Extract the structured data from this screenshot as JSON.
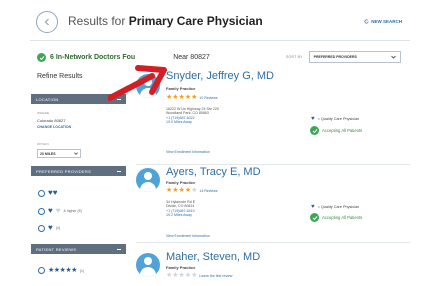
{
  "header": {
    "title_prefix": "Results for ",
    "title_bold": "Primary Care Physician",
    "new_search": "NEW SEARCH"
  },
  "results": {
    "count_bold": "6 In-Network Doctors Fou",
    "count_rest": "Near 80827",
    "sort_label": "SORT BY",
    "sort_value": "PREFERRED PROVIDERS"
  },
  "sidebar": {
    "refine_title": "Refine Results",
    "location": {
      "header": "LOCATION",
      "where_label": "WHERE",
      "where_value": "Colorado 80827",
      "change_link": "CHANGE LOCATION",
      "within_label": "WITHIN",
      "within_value": "20 MILES"
    },
    "preferred": {
      "header": "PREFERRED PROVIDERS",
      "opt2_text": "& higher (5)",
      "opt3_text": "(4)"
    },
    "reviews": {
      "header": "PATIENT REVIEWS",
      "opt1_text": "(1)"
    }
  },
  "doctors": [
    {
      "name": "Snyder, Jeffrey G, MD",
      "specialty": "Family Practice",
      "reviews": "10 Reviews",
      "address1": "16222 W Us Highway 24 Ste 220",
      "address2": "Woodland Park, CO 80863",
      "phone": "+1 (719)687-6022",
      "distance": "19.0 Miles Away",
      "view": "View Enrollment Information",
      "quality": "= Quality Care Physician",
      "accepting": "Accepting All Patients"
    },
    {
      "name": "Ayers, Tracy E, MD",
      "specialty": "Family Practice",
      "reviews": "14 Reviews",
      "address1": "34 Hylanode Rd E",
      "address2": "Divide, CO 80814",
      "phone": "+1 (719)687-6410",
      "distance": "19.2 Miles Away",
      "view": "View Enrollment Information",
      "quality": "= Quality Care Physician",
      "accepting": "Accepting All Patients"
    },
    {
      "name": "Maher, Steven, MD",
      "specialty": "Family Practice",
      "reviews": "Leave the first review"
    }
  ],
  "icons": {
    "back": "chevron-left-icon",
    "refresh": "refresh-icon",
    "check": "check-circle-icon",
    "heart": "heart-icon",
    "star": "star-icon",
    "avatar": "person-icon",
    "arrow": "red-arrow-annotation"
  },
  "colors": {
    "accent": "#2e6da4",
    "panel": "#5f6f7f",
    "green": "#3aa757",
    "star": "#f0a21b",
    "arrow": "#d21f26"
  }
}
